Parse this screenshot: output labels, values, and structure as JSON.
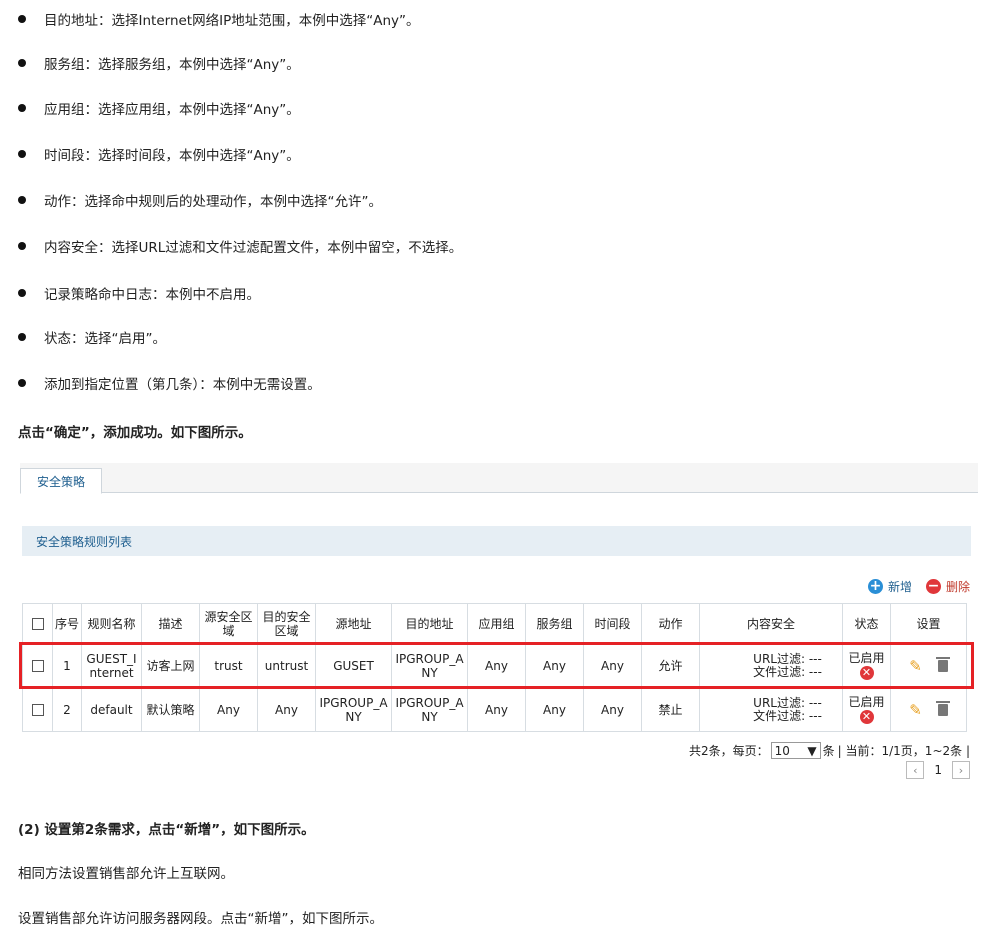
{
  "bullets": [
    "目的地址：选择Internet网络IP地址范围，本例中选择“Any”。",
    "服务组：选择服务组，本例中选择“Any”。",
    "应用组：选择应用组，本例中选择“Any”。",
    "时间段：选择时间段，本例中选择“Any”。",
    "动作：选择命中规则后的处理动作，本例中选择“允许”。",
    "内容安全：选择URL过滤和文件过滤配置文件，本例中留空，不选择。",
    "记录策略命中日志：本例中不启用。",
    "状态：选择“启用”。",
    "添加到指定位置（第几条）：本例中无需设置。"
  ],
  "confirm_text": "点击“确定”，添加成功。如下图所示。",
  "ui": {
    "tab_label": "安全策略",
    "list_title": "安全策略规则列表",
    "add_label": "新增",
    "delete_label": "删除",
    "headers": [
      "",
      "序号",
      "规则名称",
      "描述",
      "源安全区域",
      "目的安全区域",
      "源地址",
      "目的地址",
      "应用组",
      "服务组",
      "时间段",
      "动作",
      "内容安全",
      "状态",
      "设置"
    ],
    "rows": [
      {
        "index": "1",
        "name": "GUEST_Internet",
        "desc": "访客上网",
        "src_zone": "trust",
        "dst_zone": "untrust",
        "src_addr": "GUSET",
        "dst_addr": "IPGROUP_ANY",
        "app": "Any",
        "service": "Any",
        "time": "Any",
        "action": "允许",
        "url_filter": "URL过滤:  ---",
        "file_filter": "文件过滤:  ---",
        "status": "已启用"
      },
      {
        "index": "2",
        "name": "default",
        "desc": "默认策略",
        "src_zone": "Any",
        "dst_zone": "Any",
        "src_addr": "IPGROUP_ANY",
        "dst_addr": "IPGROUP_ANY",
        "app": "Any",
        "service": "Any",
        "time": "Any",
        "action": "禁止",
        "url_filter": "URL过滤:  ---",
        "file_filter": "文件过滤:  ---",
        "status": "已启用"
      }
    ],
    "pager": {
      "total": "共2条，每页：",
      "per_page": "10",
      "unit": "条",
      "current": "| 当前：1/1页，1~2条 |",
      "page": "1"
    }
  },
  "step2_title": "(2) 设置第2条需求，点击“新增”，如下图所示。",
  "line_same_method": "相同方法设置销售部允许上互联网。",
  "line_server": "设置销售部允许访问服务器网段。点击“新增”，如下图所示。",
  "colors": {
    "highlight": "#e52125",
    "accent": "#1f5f8f",
    "disabled_icon": "#e0373a"
  }
}
